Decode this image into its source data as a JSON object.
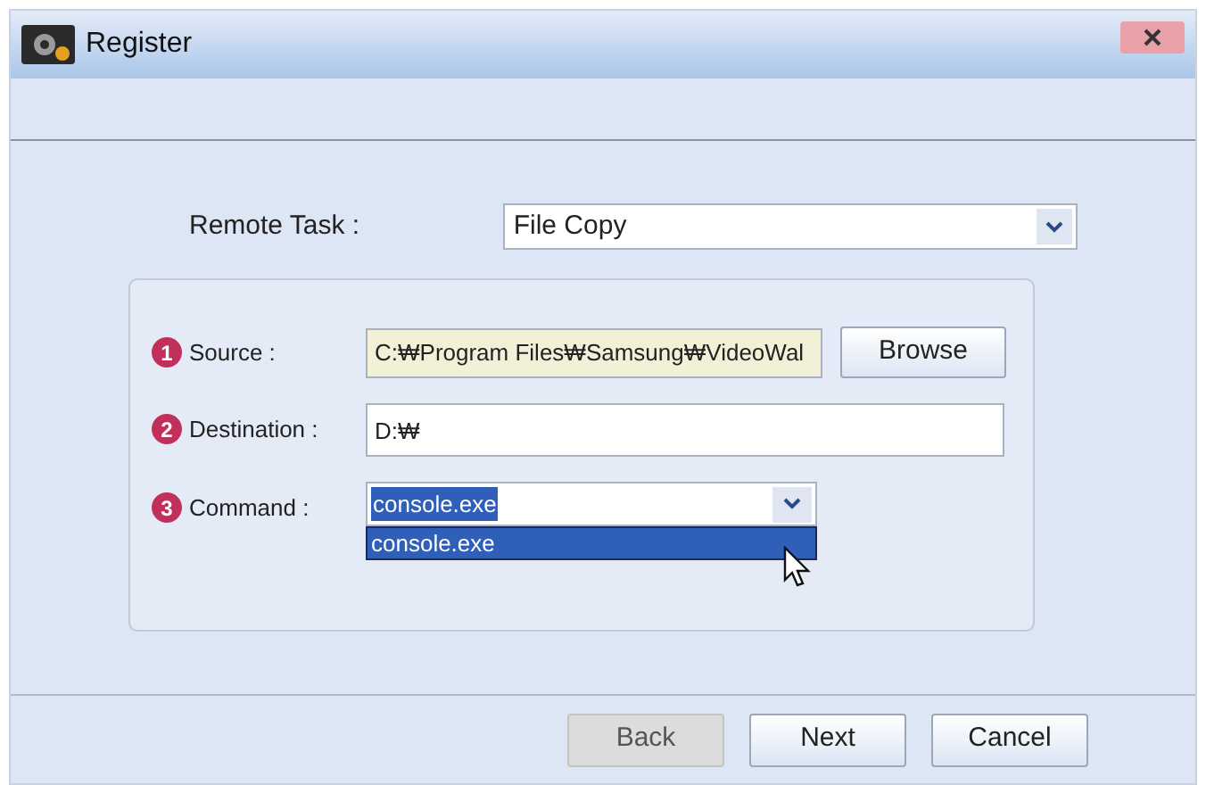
{
  "window": {
    "title": "Register"
  },
  "remote_task": {
    "label": "Remote Task :",
    "value": "File Copy"
  },
  "fields": [
    {
      "number": "1",
      "label": "Source :",
      "kind": "readonly",
      "value": "C:₩Program Files₩Samsung₩VideoWal",
      "button": "Browse"
    },
    {
      "number": "2",
      "label": "Destination :",
      "kind": "text",
      "value": "D:₩"
    },
    {
      "number": "3",
      "label": "Command :",
      "kind": "combo",
      "value": "console.exe",
      "text_selected": true,
      "expanded": true,
      "options": [
        {
          "label": "console.exe",
          "selected": true
        }
      ]
    }
  ],
  "buttons": [
    {
      "label": "Back",
      "disabled": true
    },
    {
      "label": "Next",
      "disabled": false
    },
    {
      "label": "Cancel",
      "disabled": false
    }
  ]
}
